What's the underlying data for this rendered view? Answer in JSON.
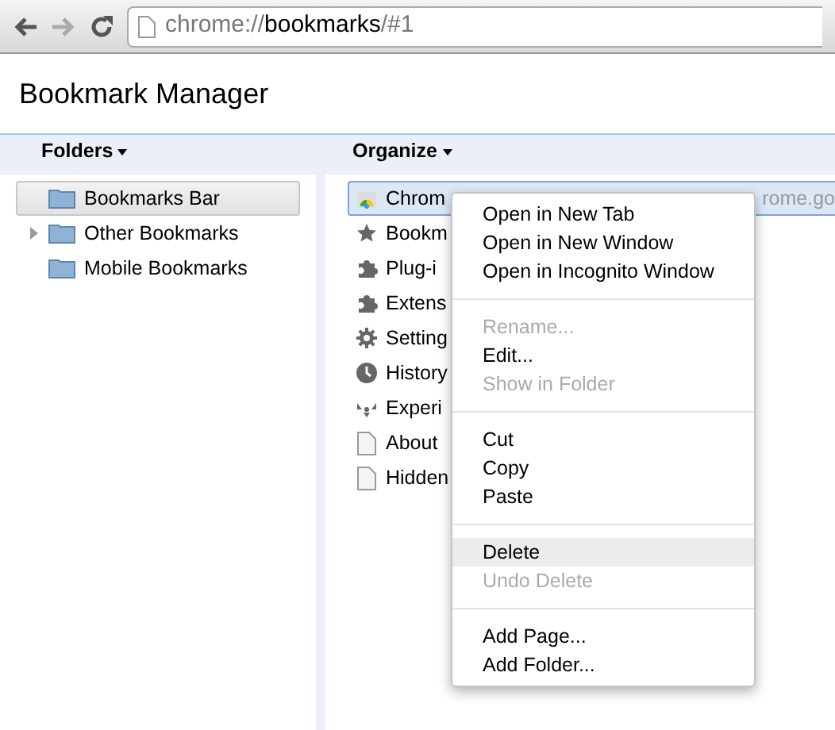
{
  "toolbar": {
    "address": [
      {
        "text": "chrome://",
        "strong": false
      },
      {
        "text": "bookmarks",
        "strong": true
      },
      {
        "text": "/#1",
        "strong": false
      }
    ]
  },
  "title": "Bookmark Manager",
  "header": {
    "folders_menu": "Folders",
    "organize_menu": "Organize"
  },
  "folders": [
    {
      "label": "Bookmarks Bar",
      "selected": true,
      "has_children": false
    },
    {
      "label": "Other Bookmarks",
      "selected": false,
      "has_children": true
    },
    {
      "label": "Mobile Bookmarks",
      "selected": false,
      "has_children": false
    }
  ],
  "bookmarks": [
    {
      "kind": "store",
      "title": "Chrom",
      "url": "rome.go",
      "selected": true
    },
    {
      "kind": "star",
      "title": "Bookm",
      "selected": false
    },
    {
      "kind": "puzzle",
      "title": "Plug-i",
      "selected": false
    },
    {
      "kind": "puzzle",
      "title": "Extens",
      "selected": false
    },
    {
      "kind": "gear",
      "title": "Setting",
      "selected": false
    },
    {
      "kind": "clock",
      "title": "History",
      "selected": false
    },
    {
      "kind": "hazard",
      "title": "Experi",
      "selected": false
    },
    {
      "kind": "page",
      "title": "About",
      "selected": false
    },
    {
      "kind": "page",
      "title": "Hidden",
      "selected": false
    }
  ],
  "context_menu": [
    {
      "kind": "item",
      "label": "Open in New Tab",
      "disabled": false,
      "selected": false
    },
    {
      "kind": "item",
      "label": "Open in New Window",
      "disabled": false,
      "selected": false
    },
    {
      "kind": "item",
      "label": "Open in Incognito Window",
      "disabled": false,
      "selected": false
    },
    {
      "kind": "separator"
    },
    {
      "kind": "item",
      "label": "Rename...",
      "disabled": true,
      "selected": false
    },
    {
      "kind": "item",
      "label": "Edit...",
      "disabled": false,
      "selected": false
    },
    {
      "kind": "item",
      "label": "Show in Folder",
      "disabled": true,
      "selected": false
    },
    {
      "kind": "separator"
    },
    {
      "kind": "item",
      "label": "Cut",
      "disabled": false,
      "selected": false
    },
    {
      "kind": "item",
      "label": "Copy",
      "disabled": false,
      "selected": false
    },
    {
      "kind": "item",
      "label": "Paste",
      "disabled": false,
      "selected": false
    },
    {
      "kind": "separator"
    },
    {
      "kind": "item",
      "label": "Delete",
      "disabled": false,
      "selected": true
    },
    {
      "kind": "item",
      "label": "Undo Delete",
      "disabled": true,
      "selected": false
    },
    {
      "kind": "separator"
    },
    {
      "kind": "item",
      "label": "Add Page...",
      "disabled": false,
      "selected": false
    },
    {
      "kind": "item",
      "label": "Add Folder...",
      "disabled": false,
      "selected": false
    }
  ]
}
